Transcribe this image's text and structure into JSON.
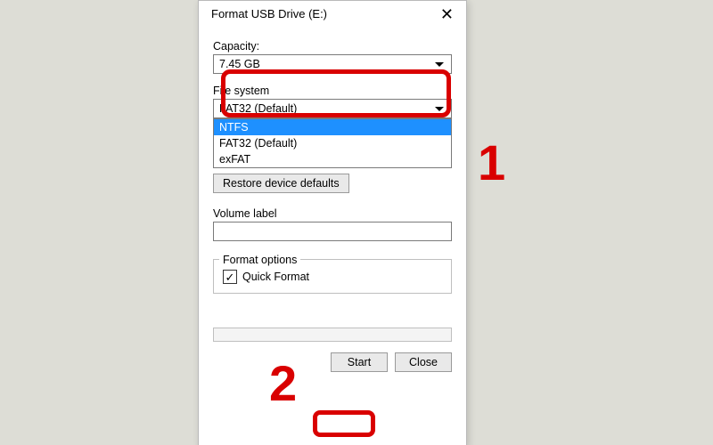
{
  "title": "Format USB Drive (E:)",
  "close_glyph": "✕",
  "capacity": {
    "label": "Capacity:",
    "value": "7.45 GB"
  },
  "filesystem": {
    "label": "File system",
    "value": "FAT32 (Default)",
    "options": [
      "NTFS",
      "FAT32 (Default)",
      "exFAT"
    ],
    "selected_index": 0
  },
  "restore_button": "Restore device defaults",
  "volume": {
    "label": "Volume label",
    "value": ""
  },
  "format_options": {
    "legend": "Format options",
    "quick_label": "Quick Format",
    "quick_checked": true,
    "check_glyph": "✓"
  },
  "buttons": {
    "start": "Start",
    "close": "Close"
  },
  "annotations": {
    "one": "1",
    "two": "2"
  }
}
